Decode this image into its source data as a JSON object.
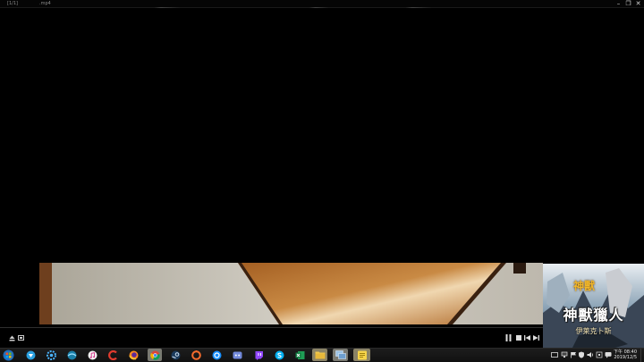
{
  "window": {
    "counter": "[1/1]",
    "filename": ".mp4",
    "minimize_label": "–",
    "restore_label": "❐",
    "close_label": "✕"
  },
  "ad": {
    "logo": "神獸",
    "title": "神獸獵人",
    "subtitle": "伊莱克卜斯"
  },
  "taskbar": {
    "clock_time": "下午 08:40",
    "clock_date": "2019/12/5",
    "apps": [
      "start-orb",
      "vpn-shield",
      "settings-gear",
      "media-player",
      "itunes",
      "ccleaner",
      "firefox",
      "chrome",
      "steam",
      "origin",
      "battle-net",
      "discord",
      "twitch",
      "skype",
      "excel",
      "file-explorer",
      "window-manager",
      "notes"
    ]
  },
  "colors": {
    "accent": "#7a7a72",
    "wood": "#b9712c",
    "floor": "#c8c3b8"
  }
}
